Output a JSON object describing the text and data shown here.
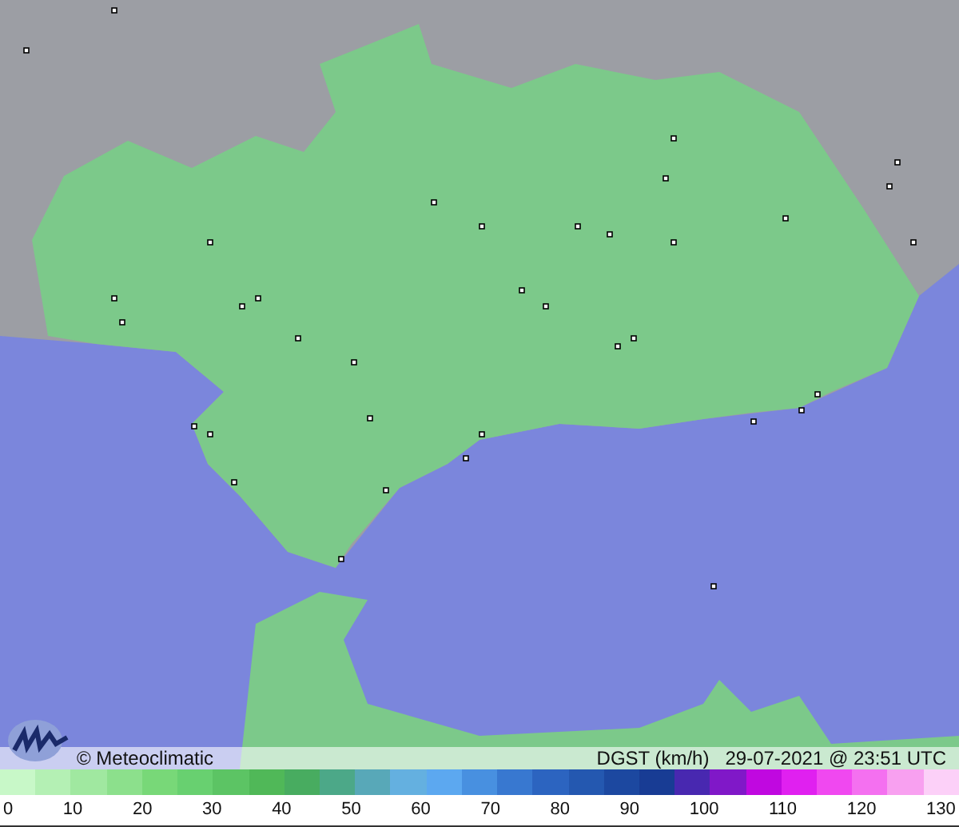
{
  "map": {
    "caption": {
      "credit": "© Meteoclimatic",
      "variable": "DGST (km/h)",
      "timestamp": "29-07-2021 @ 23:51 UTC"
    }
  },
  "legend": {
    "ticks": [
      "0",
      "10",
      "20",
      "30",
      "40",
      "50",
      "60",
      "70",
      "80",
      "90",
      "100",
      "110",
      "120",
      "130"
    ]
  }
}
